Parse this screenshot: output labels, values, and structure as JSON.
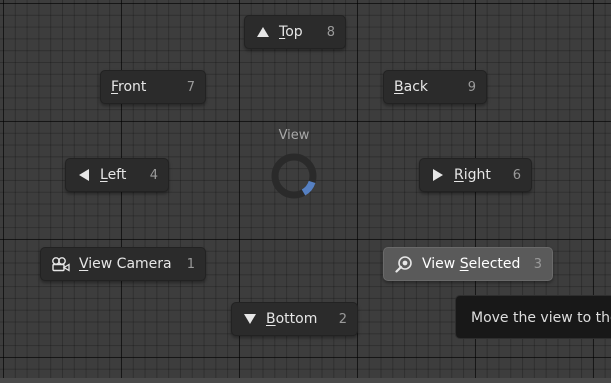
{
  "pie_menu": {
    "title": "View",
    "items": {
      "top": {
        "prefix": "",
        "mnemonic": "T",
        "rest": "op",
        "shortcut": "8",
        "icon": "triangle-up-icon"
      },
      "front": {
        "prefix": "",
        "mnemonic": "F",
        "rest": "ront",
        "shortcut": "7",
        "icon": ""
      },
      "back": {
        "prefix": "",
        "mnemonic": "B",
        "rest": "ack",
        "shortcut": "9",
        "icon": ""
      },
      "left": {
        "prefix": "",
        "mnemonic": "L",
        "rest": "eft",
        "shortcut": "4",
        "icon": "triangle-left-icon"
      },
      "right": {
        "prefix": "",
        "mnemonic": "R",
        "rest": "ight",
        "shortcut": "6",
        "icon": "triangle-right-icon"
      },
      "view_camera": {
        "prefix": "",
        "mnemonic": "V",
        "rest": "iew Camera",
        "shortcut": "1",
        "icon": "camera-icon"
      },
      "view_selected": {
        "prefix": "View ",
        "mnemonic": "S",
        "rest": "elected",
        "shortcut": "3",
        "icon": "zoom-selected-icon",
        "active": true
      },
      "bottom": {
        "prefix": "",
        "mnemonic": "B",
        "rest": "ottom",
        "shortcut": "2",
        "icon": "triangle-down-icon"
      }
    },
    "direction_indicator_color": "#5680c2"
  },
  "tooltip": {
    "text": "Move the view to the"
  },
  "colors": {
    "background": "#3d3d3d",
    "button": "#2b2b2b",
    "button_active": "#5a5a5a",
    "shortcut": "#9a9a9a"
  }
}
